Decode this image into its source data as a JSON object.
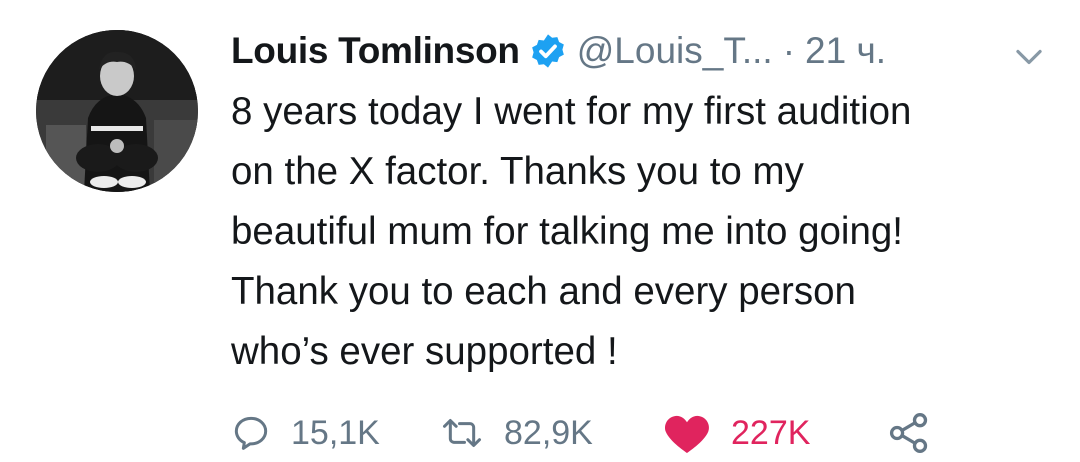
{
  "tweet": {
    "author_name": "Louis Tomlinson",
    "handle": "@Louis_T...",
    "separator": "·",
    "time": "21 ч.",
    "text_lines": [
      "8 years today I went for my first audition",
      "on the X factor. Thanks you to my",
      "beautiful mum for talking me into going!",
      "Thank you to each and every person",
      "who’s ever supported !"
    ]
  },
  "actions": {
    "replies": "15,1K",
    "retweets": "82,9K",
    "likes": "227K"
  },
  "colors": {
    "verified_blue": "#1da1f2",
    "like_red": "#e0245e",
    "muted_gray": "#657786",
    "text_dark": "#14171a"
  },
  "icons": [
    "verified-badge-icon",
    "chevron-down-icon",
    "reply-icon",
    "retweet-icon",
    "heart-icon",
    "share-icon"
  ]
}
